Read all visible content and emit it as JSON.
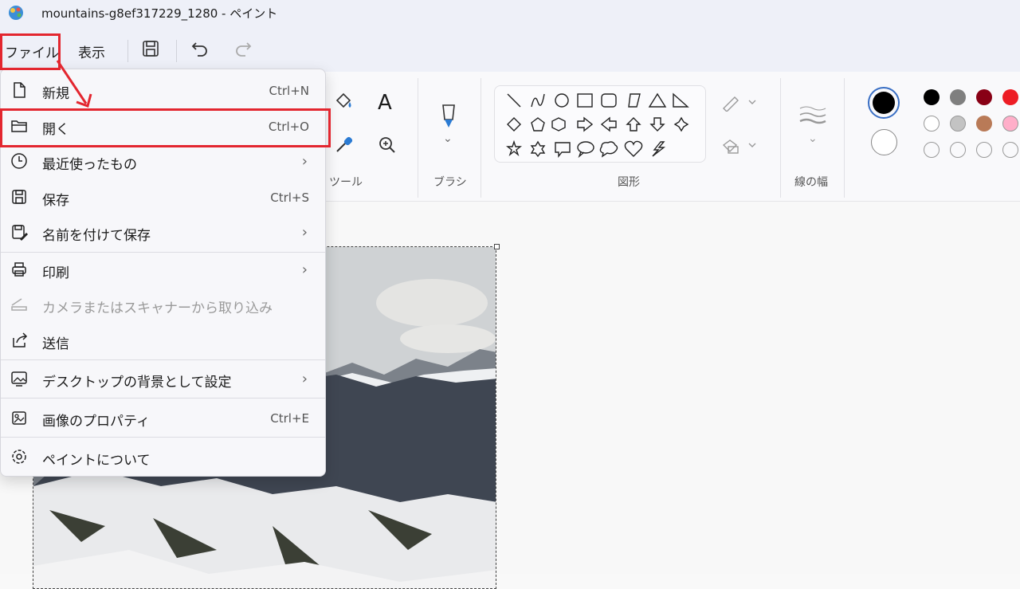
{
  "window": {
    "title": "mountains-g8ef317229_1280 - ペイント"
  },
  "menubar": {
    "file_label": "ファイル",
    "view_label": "表示"
  },
  "ribbon": {
    "tools_label": "ツール",
    "brush_label": "ブラシ",
    "shapes_label": "図形",
    "line_width_label": "線の幅",
    "text_tool_glyph": "A"
  },
  "file_menu": {
    "items": [
      {
        "label": "新規",
        "shortcut": "Ctrl+N",
        "icon": "new-file-icon"
      },
      {
        "label": "開く",
        "shortcut": "Ctrl+O",
        "icon": "open-folder-icon"
      },
      {
        "label": "最近使ったもの",
        "icon": "clock-icon"
      },
      {
        "label": "保存",
        "shortcut": "Ctrl+S",
        "icon": "save-icon"
      },
      {
        "label": "名前を付けて保存",
        "icon": "save-as-icon"
      },
      {
        "label": "印刷",
        "icon": "printer-icon"
      },
      {
        "label": "カメラまたはスキャナーから取り込み",
        "icon": "scanner-icon",
        "disabled": true
      },
      {
        "label": "送信",
        "icon": "share-icon"
      },
      {
        "label": "デスクトップの背景として設定",
        "icon": "wallpaper-icon"
      },
      {
        "label": "画像のプロパティ",
        "shortcut": "Ctrl+E",
        "icon": "image-properties-icon"
      },
      {
        "label": "ペイントについて",
        "icon": "gear-icon"
      }
    ]
  },
  "colors": {
    "highlight": "#e3262f",
    "palette": [
      "#000000",
      "#7f7f7f",
      "#880015",
      "#ed1c24",
      "#ffffff",
      "#c3c3c3",
      "#b97a57",
      "#ffaec9"
    ]
  }
}
